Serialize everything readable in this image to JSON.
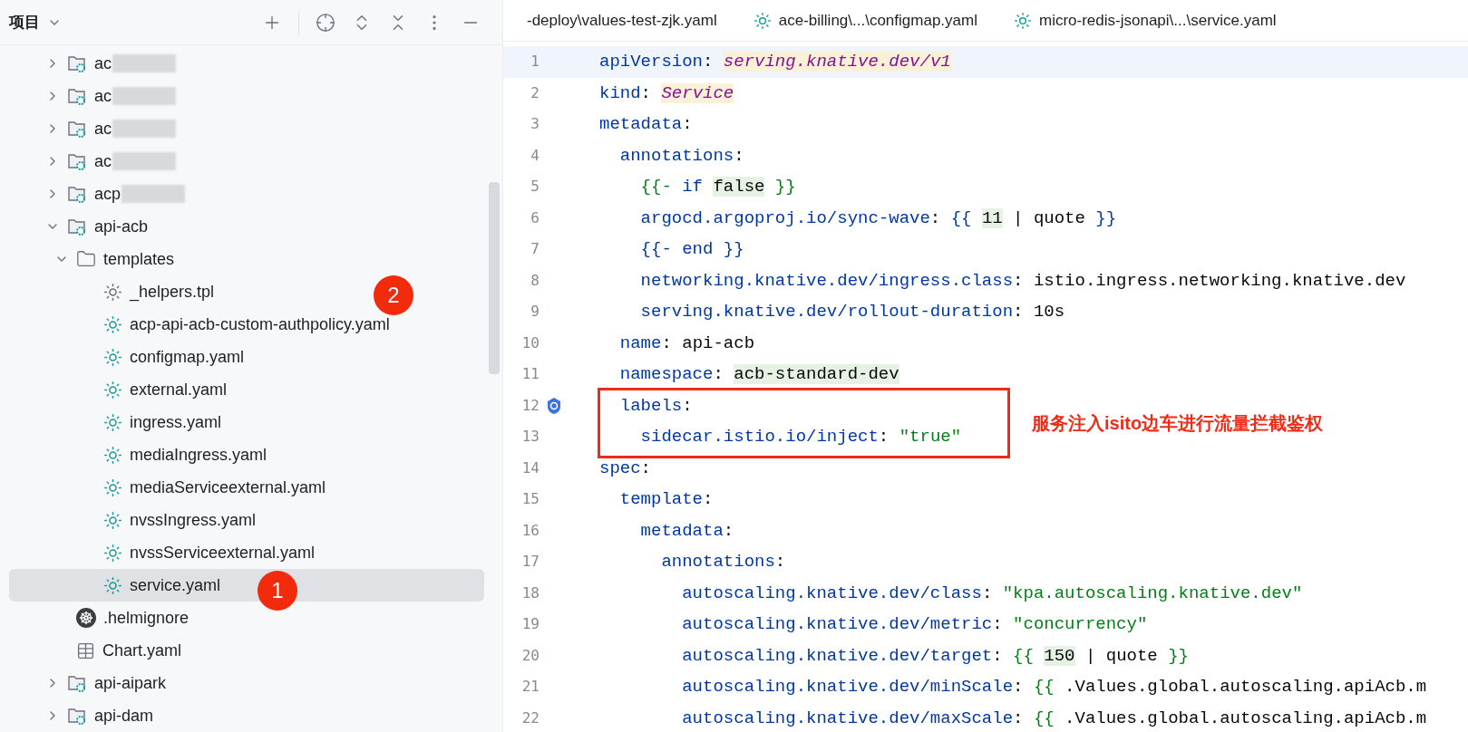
{
  "project_panel": {
    "title": "项目",
    "tree": [
      {
        "label": "ac",
        "kind": "module",
        "expanded": false,
        "selected": false,
        "redacted": true
      },
      {
        "label": "ac",
        "kind": "module",
        "expanded": false,
        "selected": false,
        "redacted": true
      },
      {
        "label": "ac",
        "kind": "module",
        "expanded": false,
        "selected": false,
        "redacted": true
      },
      {
        "label": "ac",
        "kind": "module",
        "expanded": false,
        "selected": false,
        "redacted": true
      },
      {
        "label": "acp",
        "kind": "module",
        "expanded": false,
        "selected": false,
        "redacted": true
      },
      {
        "label": "api-acb",
        "kind": "module",
        "expanded": true,
        "selected": false,
        "children": [
          {
            "label": "templates",
            "kind": "folder",
            "expanded": true,
            "selected": false,
            "children": [
              {
                "label": "_helpers.tpl",
                "kind": "tpl",
                "selected": false
              },
              {
                "label": "acp-api-acb-custom-authpolicy.yaml",
                "kind": "yaml",
                "selected": false
              },
              {
                "label": "configmap.yaml",
                "kind": "yaml",
                "selected": false
              },
              {
                "label": "external.yaml",
                "kind": "yaml",
                "selected": false
              },
              {
                "label": "ingress.yaml",
                "kind": "yaml",
                "selected": false
              },
              {
                "label": "mediaIngress.yaml",
                "kind": "yaml",
                "selected": false
              },
              {
                "label": "mediaServiceexternal.yaml",
                "kind": "yaml",
                "selected": false
              },
              {
                "label": "nvssIngress.yaml",
                "kind": "yaml",
                "selected": false
              },
              {
                "label": "nvssServiceexternal.yaml",
                "kind": "yaml",
                "selected": false
              },
              {
                "label": "service.yaml",
                "kind": "yaml",
                "selected": true
              }
            ]
          },
          {
            "label": ".helmignore",
            "kind": "helm",
            "selected": false
          },
          {
            "label": "Chart.yaml",
            "kind": "chart",
            "selected": false
          }
        ]
      },
      {
        "label": "api-aipark",
        "kind": "module",
        "expanded": false,
        "selected": false
      },
      {
        "label": "api-dam",
        "kind": "module",
        "expanded": false,
        "selected": false
      }
    ]
  },
  "markers": [
    {
      "text": "1"
    },
    {
      "text": "2"
    }
  ],
  "editor_tabs": [
    {
      "label": "-deploy\\values-test-zjk.yaml",
      "icon": false
    },
    {
      "label": "ace-billing\\...\\configmap.yaml",
      "icon": true
    },
    {
      "label": "micro-redis-jsonapi\\...\\service.yaml",
      "icon": true
    }
  ],
  "lines": [
    {
      "number": "1",
      "selected": true,
      "tokens": [
        {
          "text": "apiVersion",
          "kind": "key"
        },
        {
          "text": ": ",
          "kind": "plain"
        },
        {
          "text": "serving.knative.dev/v1",
          "kind": "tag"
        }
      ]
    },
    {
      "number": "2",
      "selected": false,
      "tokens": [
        {
          "text": "kind",
          "kind": "key"
        },
        {
          "text": ": ",
          "kind": "plain"
        },
        {
          "text": "Service",
          "kind": "tag"
        }
      ]
    },
    {
      "number": "3",
      "selected": false,
      "tokens": [
        {
          "text": "metadata",
          "kind": "key"
        },
        {
          "text": ":",
          "kind": "plain"
        }
      ]
    },
    {
      "number": "4",
      "selected": false,
      "tokens": [
        {
          "text": "  annotations",
          "kind": "key"
        },
        {
          "text": ":",
          "kind": "plain"
        }
      ]
    },
    {
      "number": "5",
      "selected": false,
      "tokens": [
        {
          "text": "    {{- ",
          "kind": "tmplg"
        },
        {
          "text": "if ",
          "kind": "key"
        },
        {
          "text": "false",
          "kind": "hl"
        },
        {
          "text": " }}",
          "kind": "tmplg"
        }
      ]
    },
    {
      "number": "6",
      "selected": false,
      "tokens": [
        {
          "text": "    argocd.argoproj.io/sync-wave",
          "kind": "key"
        },
        {
          "text": ": ",
          "kind": "plain"
        },
        {
          "text": "{{ ",
          "kind": "key"
        },
        {
          "text": "11",
          "kind": "hl"
        },
        {
          "text": " | quote ",
          "kind": "plain"
        },
        {
          "text": "}}",
          "kind": "key"
        }
      ]
    },
    {
      "number": "7",
      "selected": false,
      "tokens": [
        {
          "text": "    {{- end }}",
          "kind": "key"
        }
      ]
    },
    {
      "number": "8",
      "selected": false,
      "tokens": [
        {
          "text": "    networking.knative.dev/ingress.class",
          "kind": "key"
        },
        {
          "text": ": istio.ingress.networking.knative.dev",
          "kind": "plain"
        }
      ]
    },
    {
      "number": "9",
      "selected": false,
      "tokens": [
        {
          "text": "    serving.knative.dev/rollout-duration",
          "kind": "key"
        },
        {
          "text": ": 10s",
          "kind": "plain"
        }
      ]
    },
    {
      "number": "10",
      "selected": false,
      "tokens": [
        {
          "text": "  name",
          "kind": "key"
        },
        {
          "text": ": api-acb",
          "kind": "plain"
        }
      ]
    },
    {
      "number": "11",
      "selected": false,
      "tokens": [
        {
          "text": "  namespace",
          "kind": "key"
        },
        {
          "text": ": ",
          "kind": "plain"
        },
        {
          "text": "acb-standard-dev",
          "kind": "hl"
        }
      ]
    },
    {
      "number": "12",
      "selected": false,
      "gutter_icon": true,
      "tokens": [
        {
          "text": "  labels",
          "kind": "key"
        },
        {
          "text": ":",
          "kind": "plain"
        }
      ]
    },
    {
      "number": "13",
      "selected": false,
      "tokens": [
        {
          "text": "    sidecar.istio.io/inject",
          "kind": "key"
        },
        {
          "text": ": ",
          "kind": "plain"
        },
        {
          "text": "\"true\"",
          "kind": "str"
        }
      ]
    },
    {
      "number": "14",
      "selected": false,
      "tokens": [
        {
          "text": "spec",
          "kind": "key"
        },
        {
          "text": ":",
          "kind": "plain"
        }
      ]
    },
    {
      "number": "15",
      "selected": false,
      "tokens": [
        {
          "text": "  template",
          "kind": "key"
        },
        {
          "text": ":",
          "kind": "plain"
        }
      ]
    },
    {
      "number": "16",
      "selected": false,
      "tokens": [
        {
          "text": "    metadata",
          "kind": "key"
        },
        {
          "text": ":",
          "kind": "plain"
        }
      ]
    },
    {
      "number": "17",
      "selected": false,
      "tokens": [
        {
          "text": "      annotations",
          "kind": "key"
        },
        {
          "text": ":",
          "kind": "plain"
        }
      ]
    },
    {
      "number": "18",
      "selected": false,
      "tokens": [
        {
          "text": "        autoscaling.knative.dev/class",
          "kind": "key"
        },
        {
          "text": ": ",
          "kind": "plain"
        },
        {
          "text": "\"kpa.autoscaling.knative.dev\"",
          "kind": "str"
        }
      ]
    },
    {
      "number": "19",
      "selected": false,
      "tokens": [
        {
          "text": "        autoscaling.knative.dev/metric",
          "kind": "key"
        },
        {
          "text": ": ",
          "kind": "plain"
        },
        {
          "text": "\"concurrency\"",
          "kind": "str"
        }
      ]
    },
    {
      "number": "20",
      "selected": false,
      "tokens": [
        {
          "text": "        autoscaling.knative.dev/target",
          "kind": "key"
        },
        {
          "text": ": ",
          "kind": "plain"
        },
        {
          "text": "{{ ",
          "kind": "tmplg"
        },
        {
          "text": "150",
          "kind": "hl"
        },
        {
          "text": " | quote ",
          "kind": "plain"
        },
        {
          "text": "}}",
          "kind": "tmplg"
        }
      ]
    },
    {
      "number": "21",
      "selected": false,
      "tokens": [
        {
          "text": "        autoscaling.knative.dev/minScale",
          "kind": "key"
        },
        {
          "text": ": ",
          "kind": "plain"
        },
        {
          "text": "{{ ",
          "kind": "tmplg"
        },
        {
          "text": ".Values.global.autoscaling.apiAcb.m",
          "kind": "plain"
        }
      ]
    },
    {
      "number": "22",
      "selected": false,
      "tokens": [
        {
          "text": "        autoscaling.knative.dev/maxScale",
          "kind": "key"
        },
        {
          "text": ": ",
          "kind": "plain"
        },
        {
          "text": "{{ ",
          "kind": "tmplg"
        },
        {
          "text": ".Values.global.autoscaling.apiAcb.m",
          "kind": "plain"
        }
      ]
    }
  ],
  "callout": {
    "text": "服务注入isito边车进行流量拦截鉴权"
  }
}
